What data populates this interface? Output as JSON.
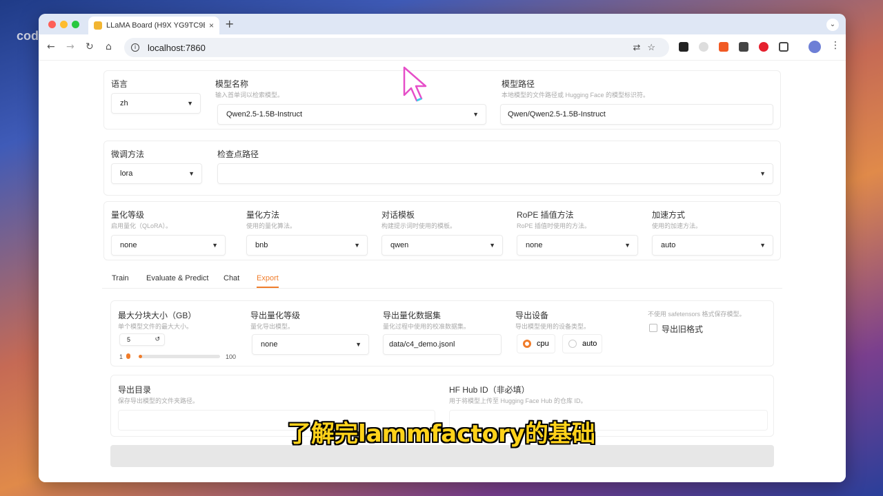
{
  "watermark": "code秘笈",
  "browser": {
    "tab_title": "LLaMA Board (H9X YG9TC9E",
    "url": "localhost:7860",
    "new_tab": "+",
    "close": "×"
  },
  "row1": {
    "lang_label": "语言",
    "lang_value": "zh",
    "model_label": "模型名称",
    "model_hint": "输入首单词以检索模型。",
    "model_value": "Qwen2.5-1.5B-Instruct",
    "path_label": "模型路径",
    "path_hint": "本地模型的文件路径或 Hugging Face 的模型标识符。",
    "path_value": "Qwen/Qwen2.5-1.5B-Instruct"
  },
  "row2": {
    "method_label": "微调方法",
    "method_value": "lora",
    "ckpt_label": "检查点路径"
  },
  "row3": [
    {
      "label": "量化等级",
      "hint": "启用量化（QLoRA）。",
      "value": "none"
    },
    {
      "label": "量化方法",
      "hint": "使用的量化算法。",
      "value": "bnb"
    },
    {
      "label": "对话模板",
      "hint": "构建提示词时使用的模板。",
      "value": "qwen"
    },
    {
      "label": "RoPE 插值方法",
      "hint": "RoPE 插值时使用的方法。",
      "value": "none"
    },
    {
      "label": "加速方式",
      "hint": "使用的加速方法。",
      "value": "auto"
    }
  ],
  "tabs": [
    "Train",
    "Evaluate & Predict",
    "Chat",
    "Export"
  ],
  "active_tab": "Export",
  "export": {
    "size_label": "最大分块大小（GB）",
    "size_hint": "单个模型文件的最大大小。",
    "size_value": "5",
    "slider_min": "1",
    "slider_max": "100",
    "slider_fraction": 0.04,
    "quant_label": "导出量化等级",
    "quant_hint": "量化导出模型。",
    "quant_value": "none",
    "dataset_label": "导出量化数据集",
    "dataset_hint": "量化过程中使用的校准数据集。",
    "dataset_value": "data/c4_demo.jsonl",
    "device_label": "导出设备",
    "device_hint": "导出模型使用的设备类型。",
    "device_cpu": "cpu",
    "device_auto": "auto",
    "legacy_hint": "不使用 safetensors 格式保存模型。",
    "legacy_label": "导出旧格式",
    "dir_label": "导出目录",
    "dir_hint": "保存导出模型的文件夹路径。",
    "hub_label": "HF Hub ID（非必填）",
    "hub_hint": "用于将模型上传至 Hugging Face Hub 的仓库 ID。"
  },
  "subtitle": "了解完lammfactory的基础"
}
